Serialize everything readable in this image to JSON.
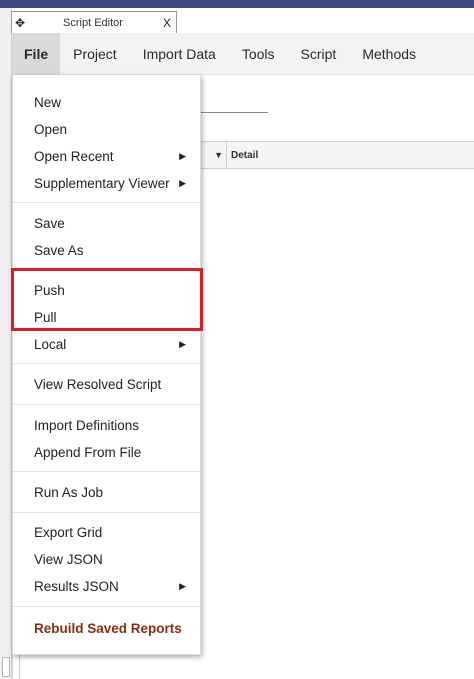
{
  "window": {
    "tab_title": "Script Editor",
    "close_label": "X",
    "move_glyph": "✥"
  },
  "menubar": {
    "items": [
      "File",
      "Project",
      "Import Data",
      "Tools",
      "Script",
      "Methods"
    ]
  },
  "grid": {
    "header_detail": "Detail",
    "filter_glyph": "▼"
  },
  "file_menu": {
    "new": "New",
    "open": "Open",
    "open_recent": "Open Recent",
    "supplementary_viewer": "Supplementary Viewer",
    "save": "Save",
    "save_as": "Save As",
    "push": "Push",
    "pull": "Pull",
    "local": "Local",
    "view_resolved_script": "View Resolved Script",
    "import_definitions": "Import Definitions",
    "append_from_file": "Append From File",
    "run_as_job": "Run As Job",
    "export_grid": "Export Grid",
    "view_json": "View JSON",
    "results_json": "Results JSON",
    "rebuild_saved_reports": "Rebuild Saved Reports",
    "submenu_arrow": "▶"
  },
  "colors": {
    "highlight_border": "#e01b24",
    "danger_text": "#8a2c0e",
    "top_bar": "#3e4a7f"
  }
}
